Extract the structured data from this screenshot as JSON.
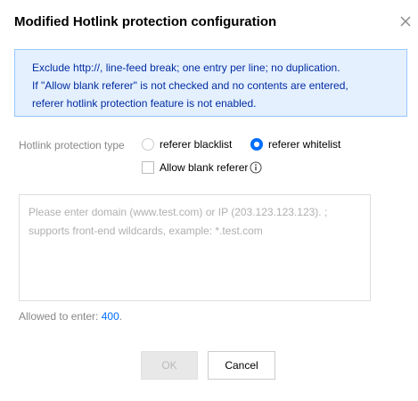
{
  "dialog": {
    "title": "Modified Hotlink protection configuration",
    "close_icon": "close-icon"
  },
  "notice": {
    "lines": [
      "Exclude http://, line-feed break; one entry per line; no duplication.",
      "If \"Allow blank referer\" is not checked and no contents are entered,",
      "referer hotlink protection feature is not enabled."
    ]
  },
  "form": {
    "type_label": "Hotlink protection type",
    "options": [
      {
        "label": "referer blacklist",
        "selected": false
      },
      {
        "label": "referer whitelist",
        "selected": true
      }
    ],
    "allow_blank_label": "Allow blank referer",
    "allow_blank_checked": false,
    "info_icon": "info-icon",
    "textarea_placeholder_line1": "Please enter domain (www.test.com) or IP (203.123.123.123).  ;",
    "textarea_placeholder_line2": "supports front-end wildcards, example: *.test.com",
    "allowed_prefix": "Allowed to enter: ",
    "allowed_count": "400",
    "allowed_suffix": "."
  },
  "buttons": {
    "ok_label": "OK",
    "cancel_label": "Cancel"
  },
  "colors": {
    "accent": "#006eff",
    "notice_bg": "#e5f0ff",
    "notice_border": "#97c7ff",
    "notice_text": "#002da0"
  }
}
